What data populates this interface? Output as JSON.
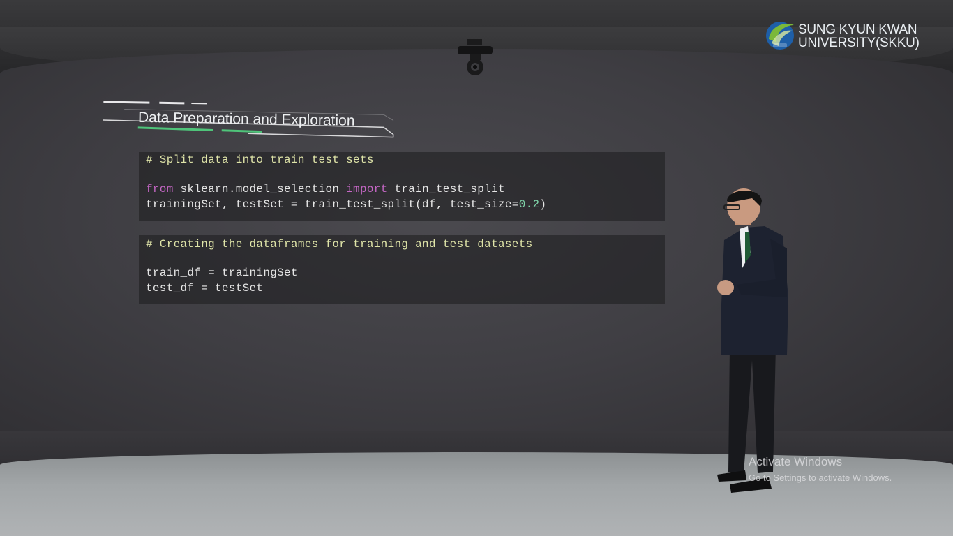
{
  "logo": {
    "line1": "SUNG KYUN KWAN",
    "line2": "UNIVERSITY(SKKU)",
    "icon": "skku-logo-icon",
    "accent_green": "#7bb83a",
    "accent_blue": "#1e5fa8"
  },
  "slide": {
    "title": "Data Preparation and Exploration",
    "code_blocks": [
      {
        "lines": [
          [
            {
              "t": "# Split data into train test sets",
              "c": "cm"
            }
          ],
          [],
          [
            {
              "t": "from",
              "c": "kw"
            },
            {
              "t": " sklearn.model_selection ",
              "c": ""
            },
            {
              "t": "import",
              "c": "kw"
            },
            {
              "t": " train_test_split",
              "c": ""
            }
          ],
          [
            {
              "t": "trainingSet, testSet = train_test_split(df, test_size=",
              "c": ""
            },
            {
              "t": "0.2",
              "c": "num"
            },
            {
              "t": ")",
              "c": ""
            }
          ]
        ]
      },
      {
        "lines": [
          [
            {
              "t": "# Creating the dataframes for training and test datasets",
              "c": "cm"
            }
          ],
          [],
          [
            {
              "t": "train_df = trainingSet",
              "c": ""
            }
          ],
          [
            {
              "t": "test_df = testSet",
              "c": ""
            }
          ]
        ]
      }
    ]
  },
  "watermark": {
    "title": "Activate Windows",
    "subtitle": "Go to Settings to activate Windows."
  },
  "colors": {
    "comment": "#dfe4a8",
    "keyword": "#c567c5",
    "number": "#7fd3a8",
    "title_underline": "#4fc47a"
  }
}
